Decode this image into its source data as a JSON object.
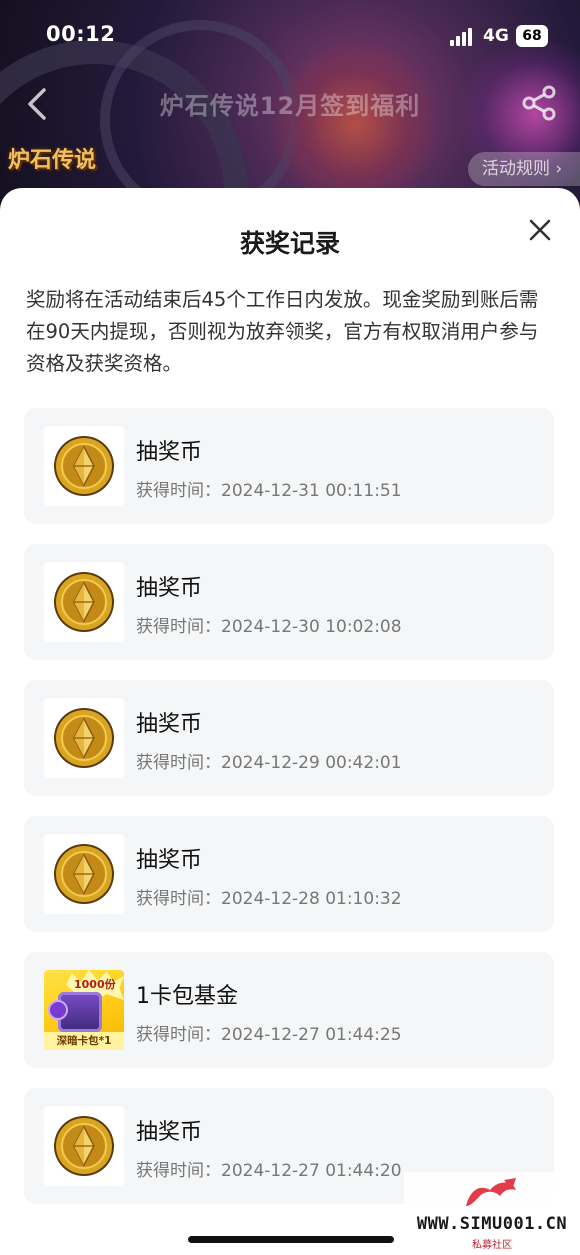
{
  "status_bar": {
    "time": "00:12",
    "network": "4G",
    "battery": "68"
  },
  "nav": {
    "title": "炉石传说12月签到福利",
    "logo_text": "炉石传说",
    "rules_label": "活动规则"
  },
  "sheet": {
    "title": "获奖记录",
    "notice": "奖励将在活动结束后45个工作日内发放。现金奖励到账后需在90天内提现，否则视为放弃领奖，官方有权取消用户参与资格及获奖资格。"
  },
  "records": [
    {
      "name": "抽奖币",
      "time_label": "获得时间：",
      "time": "2024-12-31 00:11:51",
      "icon": "coin-icon"
    },
    {
      "name": "抽奖币",
      "time_label": "获得时间：",
      "time": "2024-12-30 10:02:08",
      "icon": "coin-icon"
    },
    {
      "name": "抽奖币",
      "time_label": "获得时间：",
      "time": "2024-12-29 00:42:01",
      "icon": "coin-icon"
    },
    {
      "name": "抽奖币",
      "time_label": "获得时间：",
      "time": "2024-12-28 01:10:32",
      "icon": "coin-icon"
    },
    {
      "name": "1卡包基金",
      "time_label": "获得时间：",
      "time": "2024-12-27 01:44:25",
      "icon": "card-pack-icon",
      "badge": "1000份",
      "caption": "深暗卡包*1"
    },
    {
      "name": "抽奖币",
      "time_label": "获得时间：",
      "time": "2024-12-27 01:44:20",
      "icon": "coin-icon"
    }
  ],
  "watermark": {
    "url": "WWW.SIMU001.CN",
    "sub": "私募社区"
  },
  "colors": {
    "sheet_bg": "#ffffff",
    "card_bg": "#f5f6f7",
    "coin_gold": "#d9a520"
  }
}
